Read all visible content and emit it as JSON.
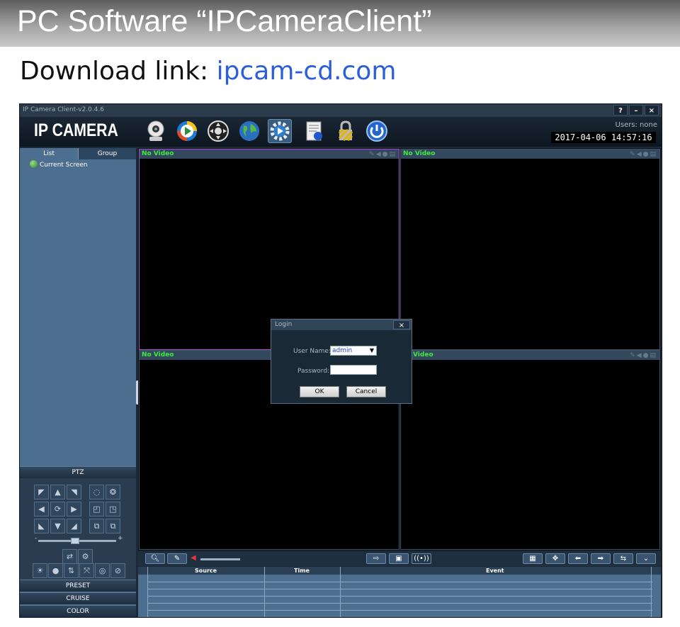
{
  "banner": {
    "title": "PC Software “IPCameraClient”"
  },
  "download": {
    "label": "Download link: ",
    "link": "ipcam-cd.com"
  },
  "window": {
    "title": "IP Camera Client-v2.0.4.6",
    "controls": [
      "?",
      "–",
      "×"
    ]
  },
  "header": {
    "logo": "IP CAMERA",
    "users": "Users: none",
    "datetime": "2017-04-06 14:57:16",
    "tools": [
      "camera-icon",
      "playback-icon",
      "ptz-control-icon",
      "globe-icon",
      "settings-icon",
      "log-icon",
      "lock-icon",
      "power-icon"
    ]
  },
  "sidebar": {
    "tabs": {
      "list": "List",
      "group": "Group"
    },
    "tree_item": "Current Screen",
    "ptz_label": "PTZ",
    "preset_label": "PRESET",
    "cruise_label": "CRUISE",
    "color_label": "COLOR",
    "slider_minus": "-",
    "slider_plus": "+"
  },
  "video": {
    "no_video": "No Video",
    "cell4_label": "Video"
  },
  "events": {
    "source": "Source",
    "time": "Time",
    "event": "Event"
  },
  "login": {
    "title": "Login",
    "close": "×",
    "username_label": "User Name:",
    "username_value": "admin",
    "password_label": "Password:",
    "ok": "OK",
    "cancel": "Cancel"
  },
  "colors": {
    "accent": "#2a5fd8",
    "no_video": "#3fe93f",
    "active_border": "#a54ad1"
  }
}
